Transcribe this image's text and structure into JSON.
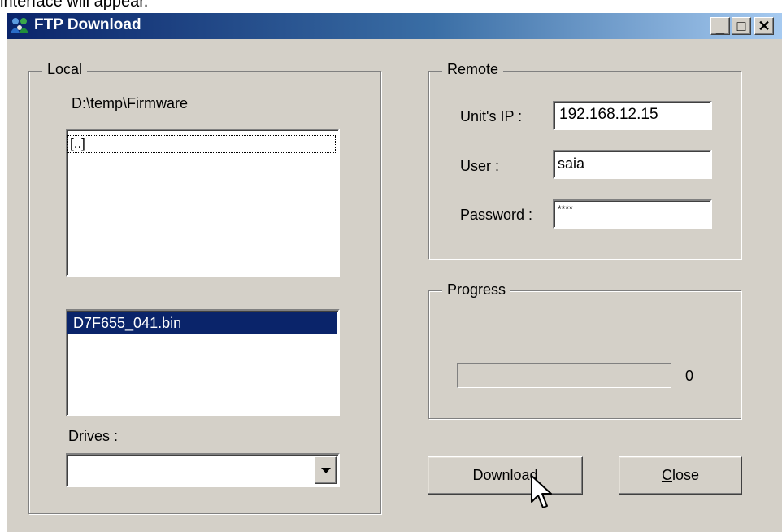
{
  "caption": "interface will appear.",
  "window": {
    "title": "FTP Download",
    "minimize": "_",
    "maximize": "□",
    "close": "✕"
  },
  "local": {
    "legend": "Local",
    "path": "D:\\temp\\Firmware",
    "directories": [
      "[..]"
    ],
    "files": [
      "D7F655_041.bin"
    ],
    "drives_label": "Drives :",
    "drive_value": ""
  },
  "remote": {
    "legend": "Remote",
    "ip_label": "Unit's IP :",
    "ip_value": "192.168.12.15",
    "user_label": "User :",
    "user_value": "saia",
    "password_label": "Password :",
    "password_value": "****"
  },
  "progress": {
    "legend": "Progress",
    "percent": 0,
    "value_text": "0"
  },
  "buttons": {
    "download": "Download",
    "close_prefix": "C",
    "close_rest": "lose"
  },
  "icons": {
    "title": "ftp-people-icon",
    "dropdown": "dropdown-arrow-icon",
    "cursor": "mouse-pointer-icon"
  }
}
